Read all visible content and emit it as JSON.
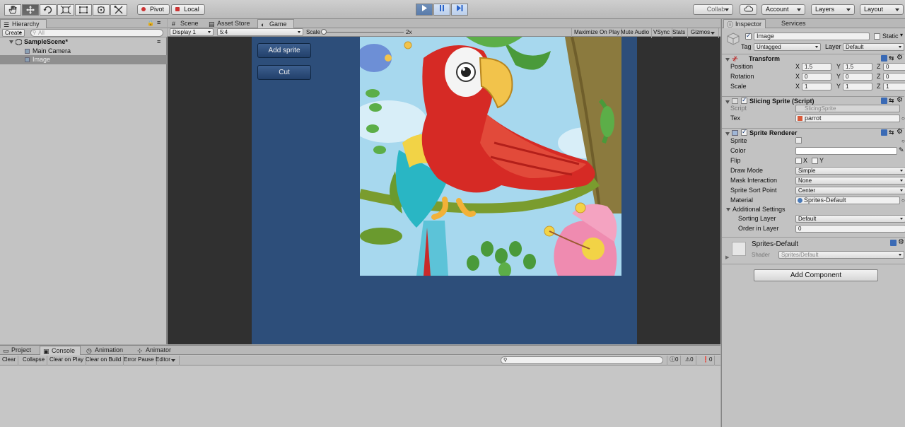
{
  "toolbar": {
    "pivot_label": "Pivot",
    "local_label": "Local",
    "collab_label": "Collab",
    "account_label": "Account",
    "layers_label": "Layers",
    "layout_label": "Layout",
    "tools": [
      "hand-icon",
      "move-icon",
      "rotate-icon",
      "scale-icon",
      "rect-tool-icon",
      "transform-icon",
      "custom-tool-icon"
    ]
  },
  "hierarchy": {
    "tab_label": "Hierarchy",
    "create_label": "Create",
    "search_placeholder": "All",
    "scene_name": "SampleScene*",
    "items": [
      "Main Camera",
      "Image"
    ],
    "selected_item": "Image"
  },
  "game_view": {
    "tabs": [
      "Scene",
      "Asset Store",
      "Game"
    ],
    "active_tab": "Game",
    "display": "Display 1",
    "aspect": "5:4",
    "scale_label": "Scale",
    "scale_value": "2x",
    "toggles": [
      "Maximize On Play",
      "Mute Audio",
      "VSync",
      "Stats",
      "Gizmos"
    ],
    "buttons": [
      "Add sprite",
      "Cut"
    ],
    "colors": {
      "background": "#2d4e7a",
      "outside": "#303030"
    }
  },
  "inspector": {
    "tabs": [
      "Inspector",
      "Services"
    ],
    "object_name": "Image",
    "static_label": "Static",
    "tag_label": "Tag",
    "tag_value": "Untagged",
    "layer_label": "Layer",
    "layer_value": "Default",
    "transform": {
      "title": "Transform",
      "rows": [
        {
          "label": "Position",
          "x": "1.5",
          "y": "1.5",
          "z": "0"
        },
        {
          "label": "Rotation",
          "x": "0",
          "y": "0",
          "z": "0"
        },
        {
          "label": "Scale",
          "x": "1",
          "y": "1",
          "z": "1"
        }
      ],
      "axis": [
        "X",
        "Y",
        "Z"
      ]
    },
    "slicing_sprite": {
      "title": "Slicing Sprite (Script)",
      "script_label": "Script",
      "script_value": "SlicingSprite",
      "tex_label": "Tex",
      "tex_value": "parrot"
    },
    "sprite_renderer": {
      "title": "Sprite Renderer",
      "sprite_label": "Sprite",
      "color_label": "Color",
      "flip_label": "Flip",
      "flip_x": "X",
      "flip_y": "Y",
      "draw_mode_label": "Draw Mode",
      "draw_mode_value": "Simple",
      "mask_label": "Mask Interaction",
      "mask_value": "None",
      "sort_point_label": "Sprite Sort Point",
      "sort_point_value": "Center",
      "material_label": "Material",
      "material_value": "Sprites-Default",
      "additional_label": "Additional Settings",
      "sorting_layer_label": "Sorting Layer",
      "sorting_layer_value": "Default",
      "order_label": "Order in Layer",
      "order_value": "0"
    },
    "material": {
      "name": "Sprites-Default",
      "shader_label": "Shader",
      "shader_value": "Sprites/Default"
    },
    "add_component_label": "Add Component"
  },
  "console": {
    "tabs": [
      "Project",
      "Console",
      "Animation",
      "Animator"
    ],
    "active_tab": "Console",
    "buttons": [
      "Clear",
      "Collapse",
      "Clear on Play",
      "Clear on Build",
      "Error Pause",
      "Editor"
    ],
    "counts": [
      "0",
      "0",
      "0"
    ]
  }
}
